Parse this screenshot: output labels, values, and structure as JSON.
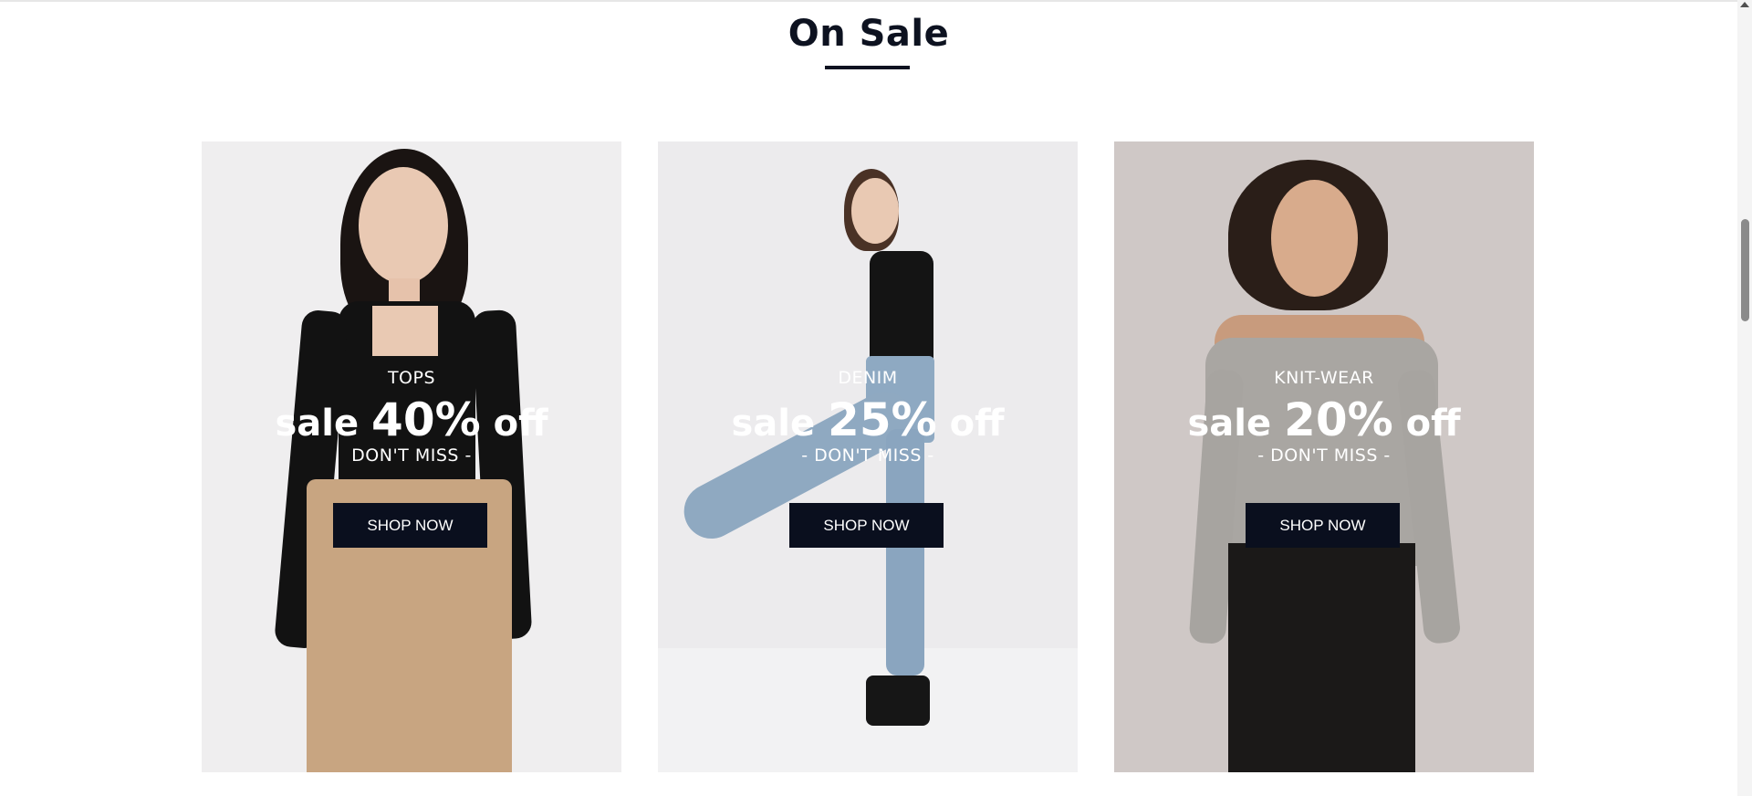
{
  "section": {
    "title": "On Sale"
  },
  "cards": [
    {
      "category": "TOPS",
      "sale_prefix": "sale ",
      "percent": "40%",
      "sale_suffix": " off",
      "tagline": "DON'T MISS -",
      "button_label": "SHOP NOW"
    },
    {
      "category": "DENIM",
      "sale_prefix": "sale ",
      "percent": "25%",
      "sale_suffix": " off",
      "tagline": "- DON'T MISS -",
      "button_label": "SHOP NOW"
    },
    {
      "category": "KNIT-WEAR",
      "sale_prefix": "sale ",
      "percent": "20%",
      "sale_suffix": " off",
      "tagline": "- DON'T MISS -",
      "button_label": "SHOP NOW"
    }
  ],
  "colors": {
    "heading": "#0d1220",
    "button_bg": "#0a0f1e",
    "overlay_text": "#ffffff"
  }
}
